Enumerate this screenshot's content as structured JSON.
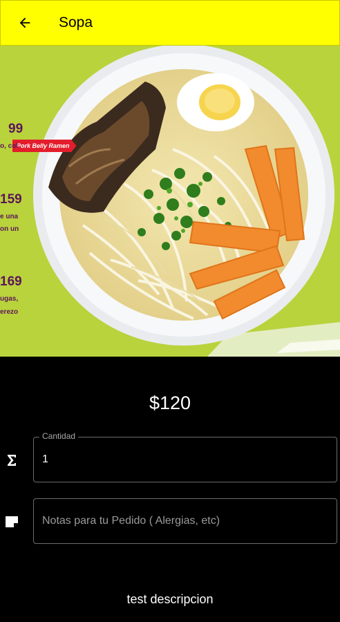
{
  "appbar": {
    "title": "Sopa",
    "back_icon": "arrow-left-icon",
    "background": "#ffff00"
  },
  "hero": {
    "menu_tag": "Pork Belly Ramen",
    "menu_prices": [
      "99",
      "159",
      "169"
    ],
    "menu_text": [
      "o, col",
      "e una",
      "on un",
      "ugas,",
      "erezo"
    ]
  },
  "product": {
    "price": "$120",
    "description": "test descripcion"
  },
  "quantity": {
    "label": "Cantidad",
    "value": "1",
    "icon": "sigma-icon"
  },
  "notes": {
    "placeholder": "Notas para tu Pedido ( Alergias, etc)",
    "value": "",
    "icon": "note-icon"
  }
}
